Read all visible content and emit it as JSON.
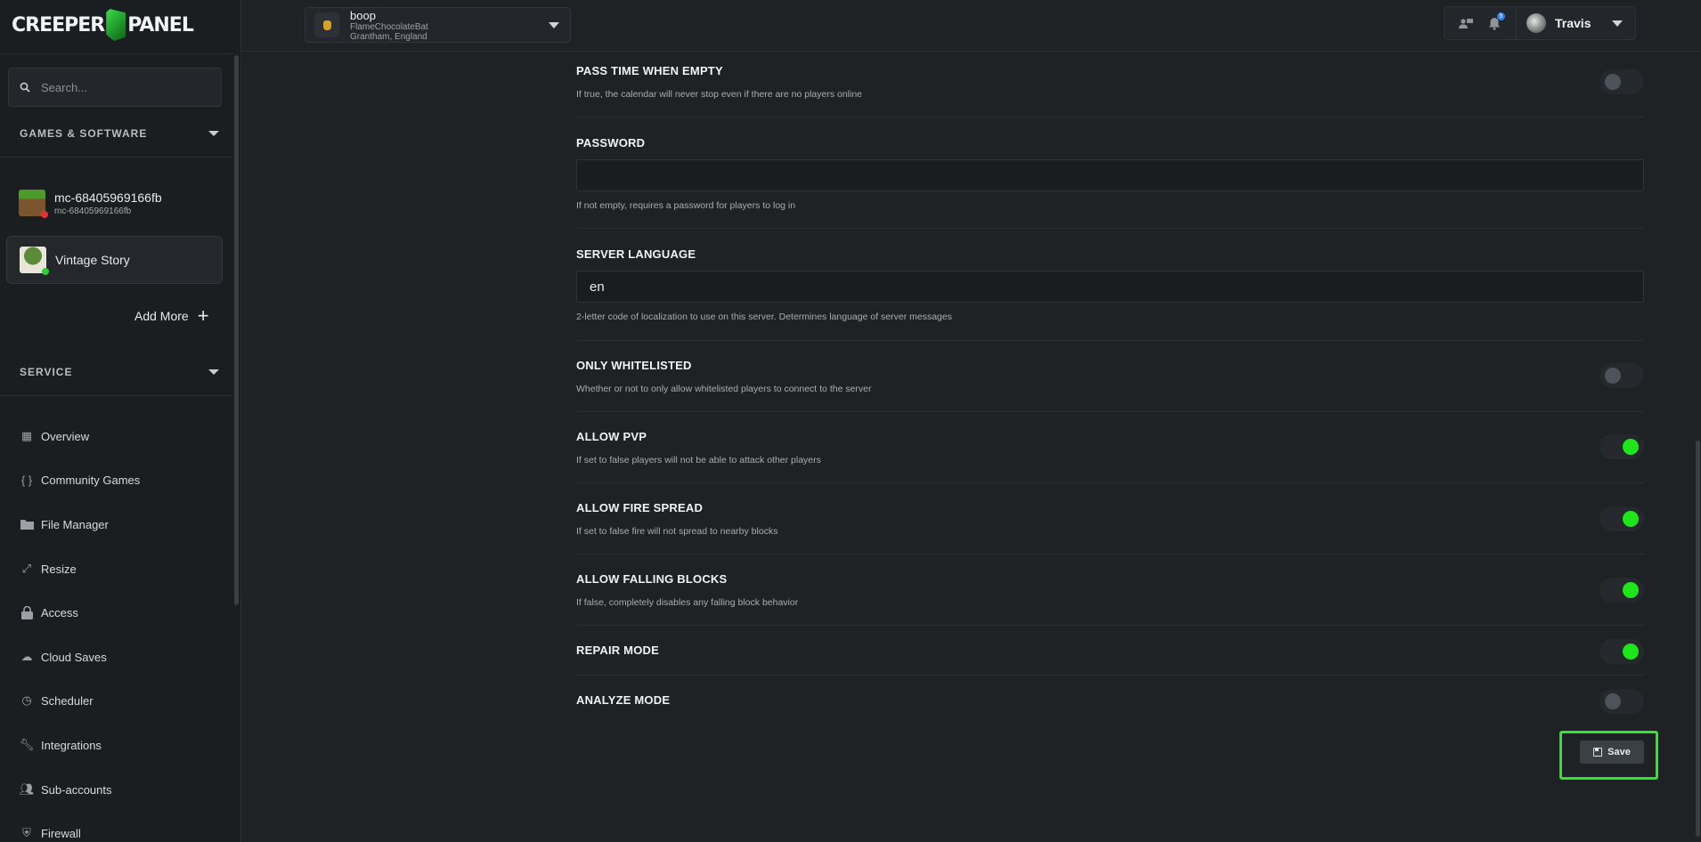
{
  "brand": {
    "logo_left": "CREEPER",
    "logo_right": "PANEL"
  },
  "search": {
    "placeholder": "Search..."
  },
  "sidebar": {
    "games_heading": "GAMES & SOFTWARE",
    "servers": [
      {
        "name": "mc-68405969166fb",
        "sub": "mc-68405969166fb",
        "status_color": "#e5332a"
      },
      {
        "name": "Vintage Story",
        "sub": "",
        "status_color": "#29d42e"
      }
    ],
    "add_more": "Add More",
    "service_heading": "SERVICE",
    "nav": [
      {
        "label": "Overview",
        "icon": "grid-icon"
      },
      {
        "label": "Community Games",
        "icon": "braces-icon"
      },
      {
        "label": "File Manager",
        "icon": "folder-icon"
      },
      {
        "label": "Resize",
        "icon": "resize-icon"
      },
      {
        "label": "Access",
        "icon": "lock-icon"
      },
      {
        "label": "Cloud Saves",
        "icon": "cloud-icon"
      },
      {
        "label": "Scheduler",
        "icon": "clock-icon"
      },
      {
        "label": "Integrations",
        "icon": "wrench-icon"
      },
      {
        "label": "Sub-accounts",
        "icon": "users-icon"
      },
      {
        "label": "Firewall",
        "icon": "shield-icon"
      }
    ]
  },
  "header": {
    "server_name": "boop",
    "server_host": "FlameChocolateBat",
    "server_location": "Grantham, England",
    "notification_count": "5",
    "username": "Travis"
  },
  "settings": [
    {
      "label": "PASS TIME WHEN EMPTY",
      "desc": "If true, the calendar will never stop even if there are no players online",
      "type": "toggle",
      "on": false
    },
    {
      "label": "PASSWORD",
      "desc": "If not empty, requires a password for players to log in",
      "type": "text",
      "value": ""
    },
    {
      "label": "SERVER LANGUAGE",
      "desc": "2-letter code of localization to use on this server. Determines language of server messages",
      "type": "text",
      "value": "en"
    },
    {
      "label": "ONLY WHITELISTED",
      "desc": "Whether or not to only allow whitelisted players to connect to the server",
      "type": "toggle",
      "on": false
    },
    {
      "label": "ALLOW PVP",
      "desc": "If set to false players will not be able to attack other players",
      "type": "toggle",
      "on": true
    },
    {
      "label": "ALLOW FIRE SPREAD",
      "desc": "If set to false fire will not spread to nearby blocks",
      "type": "toggle",
      "on": true
    },
    {
      "label": "ALLOW FALLING BLOCKS",
      "desc": "If false, completely disables any falling block behavior",
      "type": "toggle",
      "on": true
    },
    {
      "label": "REPAIR MODE",
      "desc": "",
      "type": "toggle",
      "on": true
    },
    {
      "label": "ANALYZE MODE",
      "desc": "",
      "type": "toggle",
      "on": false
    }
  ],
  "save_label": "Save",
  "colors": {
    "accent_green": "#1ee61b",
    "highlight_border": "#2ee62b",
    "notification_blue": "#2f80ed"
  }
}
